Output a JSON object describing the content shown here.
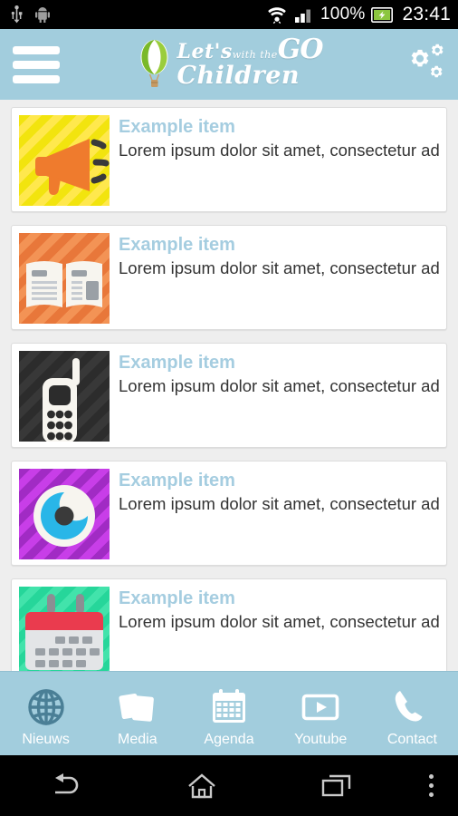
{
  "statusbar": {
    "icons": [
      "usb-icon",
      "android-icon",
      "wifi-icon",
      "signal-icon",
      "battery-icon"
    ],
    "battery_percent": "100%",
    "time": "23:41"
  },
  "header": {
    "menu_icon": "hamburger-menu-icon",
    "settings_icon": "gears-icon",
    "logo": {
      "line1_prefix": "Let's",
      "line1_go": "GO",
      "line1_tiny": "with the",
      "line2": "Children",
      "balloon_icon": "hot-air-balloon-icon",
      "birds_icon": "birds-icon"
    },
    "bg_color": "#a2cddd"
  },
  "list": {
    "items": [
      {
        "title": "Example item",
        "text": "Lorem ipsum dolor sit amet, consectetur adipiscing elit. Nunc congue tortor vel eros feugiat, nec lu",
        "thumb_icon": "megaphone-icon",
        "thumb_bg": "#f2e40e",
        "thumb_stripe": "#ffd92e",
        "glyph_color": "#ef7b2d"
      },
      {
        "title": "Example item",
        "text": "Lorem ipsum dolor sit amet, consectetur adipiscing elit. Nunc congue tortor vel eros feugiat, nec lu",
        "thumb_icon": "newspaper-icon",
        "thumb_bg": "#e8773a",
        "thumb_stripe": "#f08c4e",
        "glyph_color": "#f7f5ef"
      },
      {
        "title": "Example item",
        "text": "Lorem ipsum dolor sit amet, consectetur adipiscing elit. Nunc congue tortor vel eros feugiat, nec lu",
        "thumb_icon": "cordless-phone-icon",
        "thumb_bg": "#2e2e2e",
        "thumb_stripe": "#3a3a3a",
        "glyph_color": "#f7f5ef"
      },
      {
        "title": "Example item",
        "text": "Lorem ipsum dolor sit amet, consectetur adipiscing elit. Nunc congue tortor vel eros feugiat, nec lu",
        "thumb_icon": "eye-icon",
        "thumb_bg": "#a12bc4",
        "thumb_stripe": "#c13ee0",
        "glyph_color": "#29b6e8"
      },
      {
        "title": "Example item",
        "text": "Lorem ipsum dolor sit amet, consectetur adipiscing elit. Nunc congue tortor vel eros feugiat, nec lu",
        "thumb_icon": "calendar-icon",
        "thumb_bg": "#26d69a",
        "thumb_stripe": "#3ee0a8",
        "glyph_color": "#ea3b4e"
      }
    ]
  },
  "tabbar": {
    "active": "Nieuws",
    "tabs": [
      {
        "label": "Nieuws",
        "icon": "globe-icon",
        "active": true
      },
      {
        "label": "Media",
        "icon": "photos-icon",
        "active": false
      },
      {
        "label": "Agenda",
        "icon": "calendar-icon",
        "active": false
      },
      {
        "label": "Youtube",
        "icon": "play-icon",
        "active": false
      },
      {
        "label": "Contact",
        "icon": "phone-icon",
        "active": false
      }
    ]
  },
  "navbar": {
    "buttons": [
      {
        "name": "back-button",
        "icon": "back-arrow-icon"
      },
      {
        "name": "home-button",
        "icon": "home-icon"
      },
      {
        "name": "recents-button",
        "icon": "recents-icon"
      },
      {
        "name": "overflow-button",
        "icon": "overflow-dots-icon"
      }
    ]
  },
  "colors": {
    "accent": "#a2cddd",
    "title": "#a5cde0",
    "page_bg": "#eeeeee",
    "tab_active": "#4a7f96"
  }
}
